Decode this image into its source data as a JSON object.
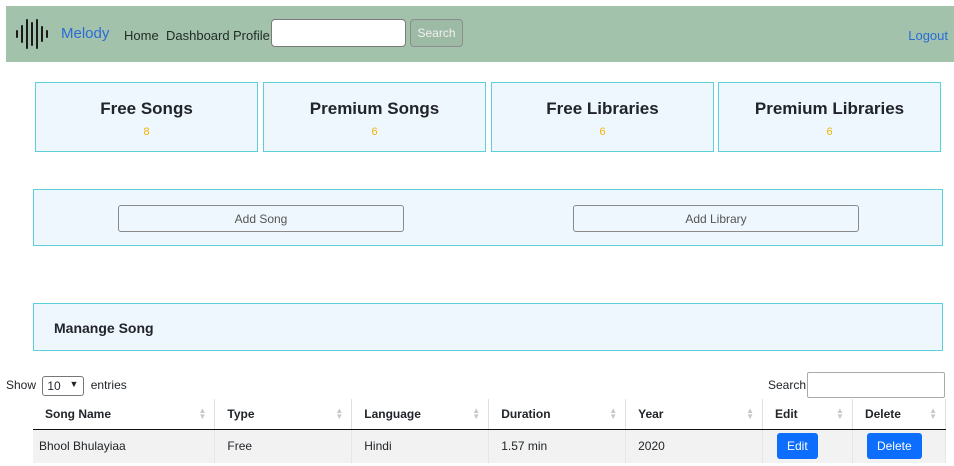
{
  "navbar": {
    "brand": "Melody",
    "logo_icon": "sound-wave-icon",
    "links": [
      "Home",
      "Dashboard",
      "Profile"
    ],
    "search_placeholder": "",
    "search_button": "Search",
    "logout": "Logout"
  },
  "stats": [
    {
      "title": "Free Songs",
      "value": "8"
    },
    {
      "title": "Premium Songs",
      "value": "6"
    },
    {
      "title": "Free Libraries",
      "value": "6"
    },
    {
      "title": "Premium Libraries",
      "value": "6"
    }
  ],
  "actions": {
    "add_song": "Add Song",
    "add_library": "Add Library"
  },
  "manage": {
    "title": "Manange Song"
  },
  "table_controls": {
    "show_label": "Show",
    "entries_value": "10",
    "entries_label": "entries",
    "search_label": "Search:"
  },
  "table": {
    "headers": [
      "Song Name",
      "Type",
      "Language",
      "Duration",
      "Year",
      "Edit",
      "Delete"
    ],
    "rows": [
      {
        "song_name": "Bhool Bhulayiaa",
        "type": "Free",
        "language": "Hindi",
        "duration": "1.57 min",
        "year": "2020",
        "edit": "Edit",
        "delete": "Delete"
      }
    ]
  },
  "colors": {
    "navbar_bg": "#a3c2ab",
    "brand": "#2a6cd6",
    "panel_bg": "#eef7fd",
    "panel_border": "#5bd0da",
    "stat_value": "#f0b400",
    "primary_button": "#0d6efd"
  }
}
